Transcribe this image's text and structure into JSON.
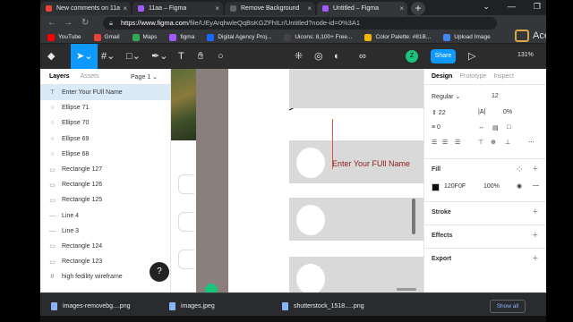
{
  "tabs": [
    {
      "title": "New comments on 11a",
      "favicon_color": "#ea4335"
    },
    {
      "title": "11aa – Figma",
      "favicon_color": "#a259ff"
    },
    {
      "title": "Remove Background",
      "favicon_color": "#5f6368"
    },
    {
      "title": "Untitled – Figma",
      "favicon_color": "#a259ff"
    }
  ],
  "address": {
    "url_host": "https://www.figma.com",
    "url_path": "/file/UEyArqhwleQqBsKGZFhILr/Untitled?node-id=0%3A1"
  },
  "bookmarks": [
    {
      "label": "YouTube",
      "color": "#ff0000"
    },
    {
      "label": "Gmail",
      "color": "#ea4335"
    },
    {
      "label": "Maps",
      "color": "#34a853"
    },
    {
      "label": "figma",
      "color": "#a259ff"
    },
    {
      "label": "Digital Agency Proj...",
      "color": "#1769ff"
    },
    {
      "label": "Uicons: 8,100+ Free...",
      "color": "#444444"
    },
    {
      "label": "Color Palette: #81B...",
      "color": "#f4b400"
    },
    {
      "label": "Upload Image",
      "color": "#4285f4"
    }
  ],
  "toolbar": {
    "avatar": "Z",
    "share": "Share",
    "zoom": "131%"
  },
  "layers_panel": {
    "tab_layers": "Layers",
    "tab_assets": "Assets",
    "page": "Page 1",
    "items": [
      {
        "name": "Enter Your FUll Name",
        "glyph": "T"
      },
      {
        "name": "Ellipse 71",
        "glyph": "○"
      },
      {
        "name": "Ellipse 70",
        "glyph": "○"
      },
      {
        "name": "Ellipse 69",
        "glyph": "○"
      },
      {
        "name": "Ellipse 68",
        "glyph": "○"
      },
      {
        "name": "Rectangle 127",
        "glyph": "▭"
      },
      {
        "name": "Rectangle 126",
        "glyph": "▭"
      },
      {
        "name": "Rectangle 125",
        "glyph": "▭"
      },
      {
        "name": "Line 4",
        "glyph": "—"
      },
      {
        "name": "Line 3",
        "glyph": "—"
      },
      {
        "name": "Rectangle 124",
        "glyph": "▭"
      },
      {
        "name": "Rectangle 123",
        "glyph": "▭"
      },
      {
        "name": "high fedility wireframe",
        "glyph": "#"
      }
    ]
  },
  "canvas": {
    "text_layer": "Enter Your FUll Name"
  },
  "design_panel": {
    "tab_design": "Design",
    "tab_prototype": "Prototype",
    "tab_inspect": "Inspect",
    "font_weight": "Regular",
    "font_size": "12",
    "line_height": "22",
    "letter_spacing": "0",
    "fill_label": "Fill",
    "fill_hex": "120F0F",
    "fill_opacity": "100%",
    "stroke_label": "Stroke",
    "effects_label": "Effects",
    "export_label": "Export",
    "fill_color": "#120f0f"
  },
  "downloads": {
    "files": [
      "images-removebg....png",
      "images.jpeg",
      "shutterstock_1518.....png"
    ],
    "show_all": "Show all"
  },
  "watermark": "AceMovi"
}
